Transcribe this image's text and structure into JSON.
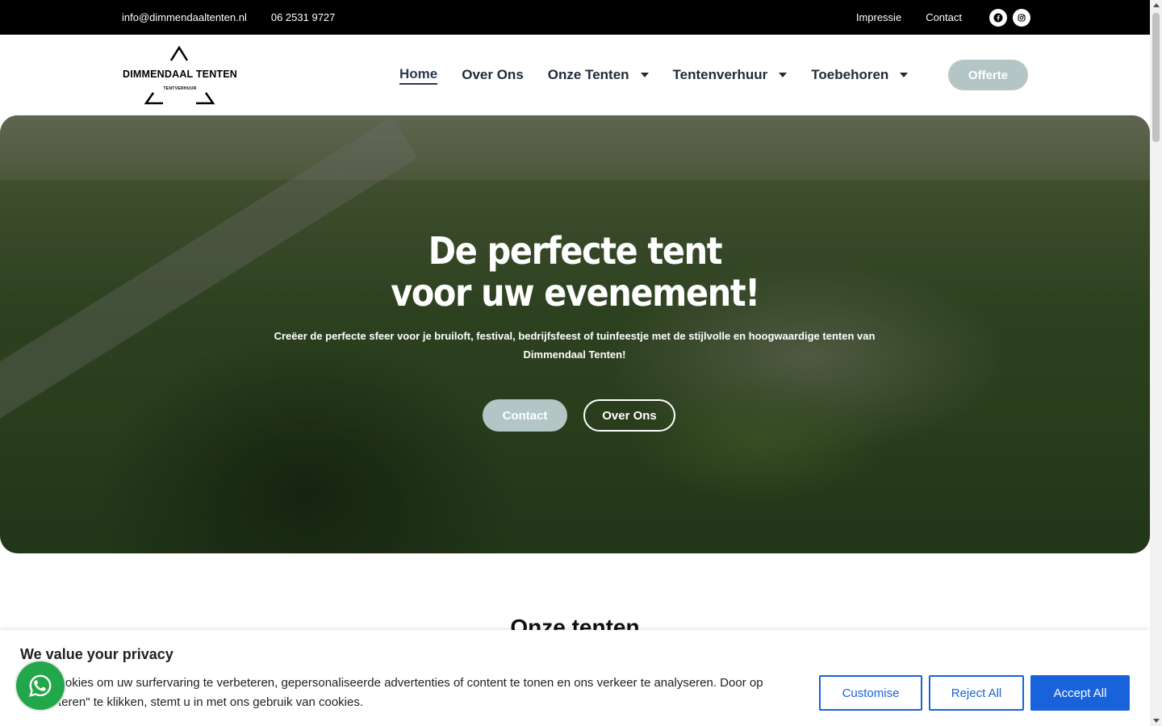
{
  "topbar": {
    "email": "info@dimmendaaltenten.nl",
    "phone": "06 2531 9727",
    "links": {
      "impressie": "Impressie",
      "contact": "Contact"
    },
    "social": {
      "facebook_icon": "facebook-icon",
      "instagram_icon": "instagram-icon"
    }
  },
  "header": {
    "logo": {
      "title": "DIMMENDAAL TENTEN",
      "subtitle": "TENTVERHUUR"
    },
    "nav": {
      "home": "Home",
      "over_ons": "Over Ons",
      "onze_tenten": "Onze Tenten",
      "tentenverhuur": "Tentenverhuur",
      "toebehoren": "Toebehoren"
    },
    "offerte": "Offerte"
  },
  "hero": {
    "title_line1": "De perfecte tent",
    "title_line2": "voor uw evenement!",
    "subtitle": "Creëer de perfecte sfeer voor je bruiloft, festival, bedrijfsfeest of tuinfeestje met de stijlvolle en hoogwaardige tenten van Dimmendaal Tenten!",
    "button_contact": "Contact",
    "button_over_ons": "Over Ons"
  },
  "section": {
    "title": "Onze tenten"
  },
  "cookie": {
    "title": "We value your privacy",
    "text": "uiken cookies om uw surfervaring te verbeteren, gepersonaliseerde advertenties of content te tonen en ons verkeer te analyseren. Door op \"Accepteren\" te klikken, stemt u in met ons gebruik van cookies.",
    "customise": "Customise",
    "reject": "Reject All",
    "accept": "Accept All"
  },
  "colors": {
    "accent_button": "#b3c5c5",
    "cookie_blue": "#1863dc",
    "whatsapp_green": "#22a84a",
    "nav_text": "#1f2a3a"
  }
}
